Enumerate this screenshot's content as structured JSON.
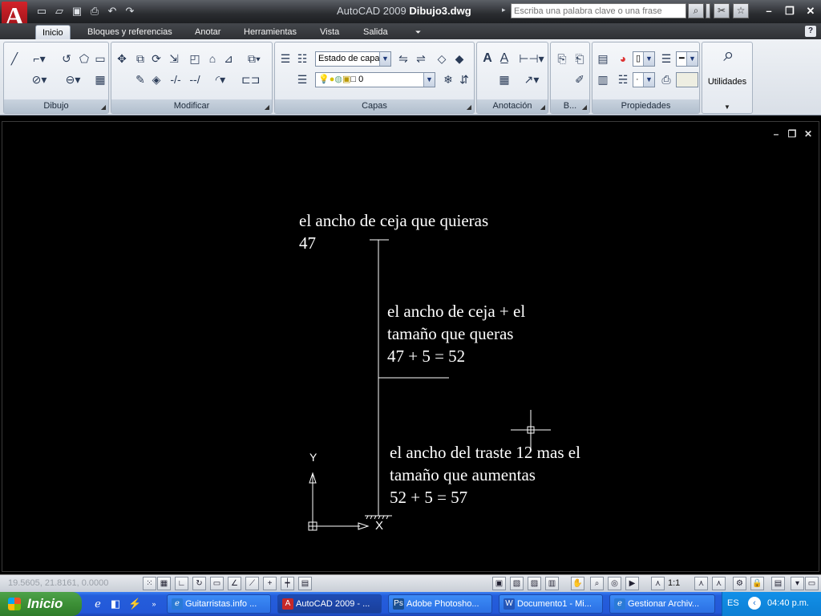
{
  "app": {
    "title_prefix": "AutoCAD 2009",
    "title_file": "Dibujo3.dwg",
    "search_placeholder": "Escriba una palabra clave o una frase"
  },
  "tabs": [
    "Inicio",
    "Bloques y referencias",
    "Anotar",
    "Herramientas",
    "Vista",
    "Salida"
  ],
  "ribbon": {
    "panels": {
      "dibujo": "Dibujo",
      "modificar": "Modificar",
      "capas": "Capas",
      "anotacion": "Anotación",
      "bloques": "B...",
      "propiedades": "Propiedades"
    },
    "layer_state": "Estado de capa",
    "layer_current": "0",
    "utilities_label": "Utilidades"
  },
  "drawing": {
    "text1_line1": "el ancho de ceja que quieras",
    "text1_line2": "47",
    "text2_line1": "el ancho de ceja + el",
    "text2_line2": "tamaño que queras",
    "text2_line3": "47 + 5 = 52",
    "text3_line1": "el ancho del traste 12 mas el",
    "text3_line2": "tamaño que aumentas",
    "text3_line3": "52 + 5 = 57",
    "ucs_y": "Y",
    "ucs_x": "X"
  },
  "status": {
    "coords": "19.5605, 21.8161, 0.0000",
    "annotation_scale": "1:1"
  },
  "taskbar": {
    "start": "Inicio",
    "tasks": [
      "Guitarristas.info ...",
      "AutoCAD 2009 - ...",
      "Adobe Photosho...",
      "Documento1 - Mi...",
      "Gestionar Archiv..."
    ],
    "lang": "ES",
    "time": "04:40 p.m."
  }
}
